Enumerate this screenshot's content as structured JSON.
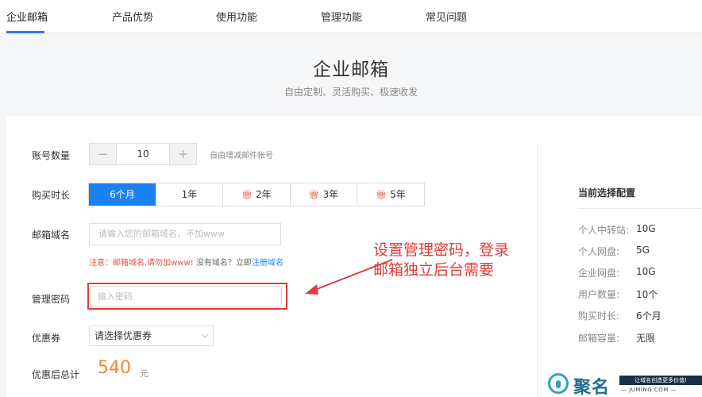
{
  "nav": {
    "items": [
      {
        "label": "企业邮箱",
        "active": true
      },
      {
        "label": "产品优势",
        "active": false
      },
      {
        "label": "使用功能",
        "active": false
      },
      {
        "label": "管理功能",
        "active": false
      },
      {
        "label": "常见问题",
        "active": false
      }
    ]
  },
  "hero": {
    "title": "企业邮箱",
    "subtitle": "自由定制、灵活购买、极速收发"
  },
  "form": {
    "account_count": {
      "label": "账号数量",
      "minus": "−",
      "value": "10",
      "plus": "+",
      "hint": "自由增减邮件帐号"
    },
    "duration": {
      "label": "购买时长",
      "options": [
        {
          "label": "6个月",
          "selected": true,
          "gift": false
        },
        {
          "label": "1年",
          "selected": false,
          "gift": false
        },
        {
          "label": "2年",
          "selected": false,
          "gift": true
        },
        {
          "label": "3年",
          "selected": false,
          "gift": true
        },
        {
          "label": "5年",
          "selected": false,
          "gift": true
        }
      ],
      "gift_icon": "gift-icon"
    },
    "domain": {
      "label": "邮箱域名",
      "placeholder": "请输入您的邮箱域名，不加www",
      "note_warning": "注意：邮箱域名,请勿加www!",
      "note_question": "没有域名？立即",
      "note_link": "注册域名"
    },
    "password": {
      "label": "管理密码",
      "placeholder": "输入密码"
    },
    "coupon": {
      "label": "优惠券",
      "selected": "请选择优惠券"
    },
    "total": {
      "label": "优惠后总计",
      "price": "540",
      "unit": "元"
    }
  },
  "annotation": {
    "text": "设置管理密码，登录\n邮箱独立后台需要",
    "color": "#e23a3a"
  },
  "summary": {
    "title": "当前选择配置",
    "rows": [
      {
        "key": "个人中转站:",
        "value": "10G"
      },
      {
        "key": "个人网盘:",
        "value": "5G"
      },
      {
        "key": "企业网盘:",
        "value": "10G"
      },
      {
        "key": "用户数量:",
        "value": "10个"
      },
      {
        "key": "购买时长:",
        "value": "6个月"
      },
      {
        "key": "邮箱容量:",
        "value": "无限"
      }
    ]
  },
  "watermark": {
    "brand": "聚名",
    "slogan": "让域名创造更多价值!",
    "url": "— JUMING.COM —"
  },
  "colors": {
    "accent": "#1a82f5",
    "price": "#f7852d",
    "warning": "#e5503c",
    "annotation": "#e23a3a"
  }
}
